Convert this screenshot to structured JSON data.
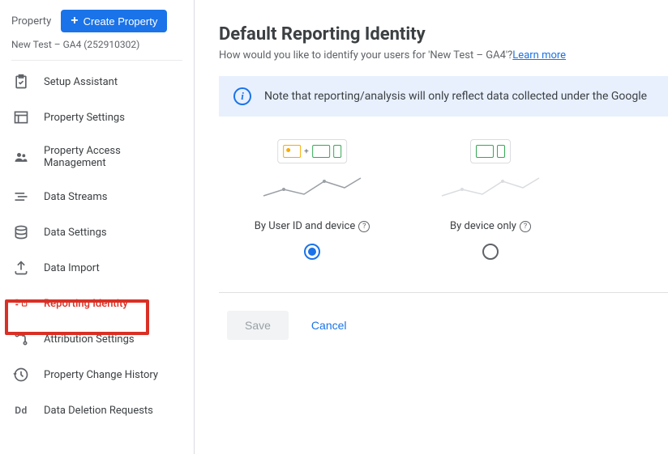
{
  "sidebar": {
    "propertyLabel": "Property",
    "createButton": "Create Property",
    "breadcrumb": "New Test  – GA4 (252910302)",
    "items": [
      {
        "label": "Setup Assistant"
      },
      {
        "label": "Property Settings"
      },
      {
        "label": "Property Access Management"
      },
      {
        "label": "Data Streams"
      },
      {
        "label": "Data Settings"
      },
      {
        "label": "Data Import"
      },
      {
        "label": "Reporting Identity"
      },
      {
        "label": "Attribution Settings"
      },
      {
        "label": "Property Change History"
      },
      {
        "label": "Data Deletion Requests"
      }
    ]
  },
  "main": {
    "title": "Default Reporting Identity",
    "subtitlePrefix": "How would you like to identify your users for 'New Test  – GA4'?",
    "learnMore": "Learn more",
    "bannerText": "Note that reporting/analysis will only reflect data collected under the Google ",
    "option1": "By User ID and device",
    "option2": "By device only",
    "save": "Save",
    "cancel": "Cancel"
  }
}
